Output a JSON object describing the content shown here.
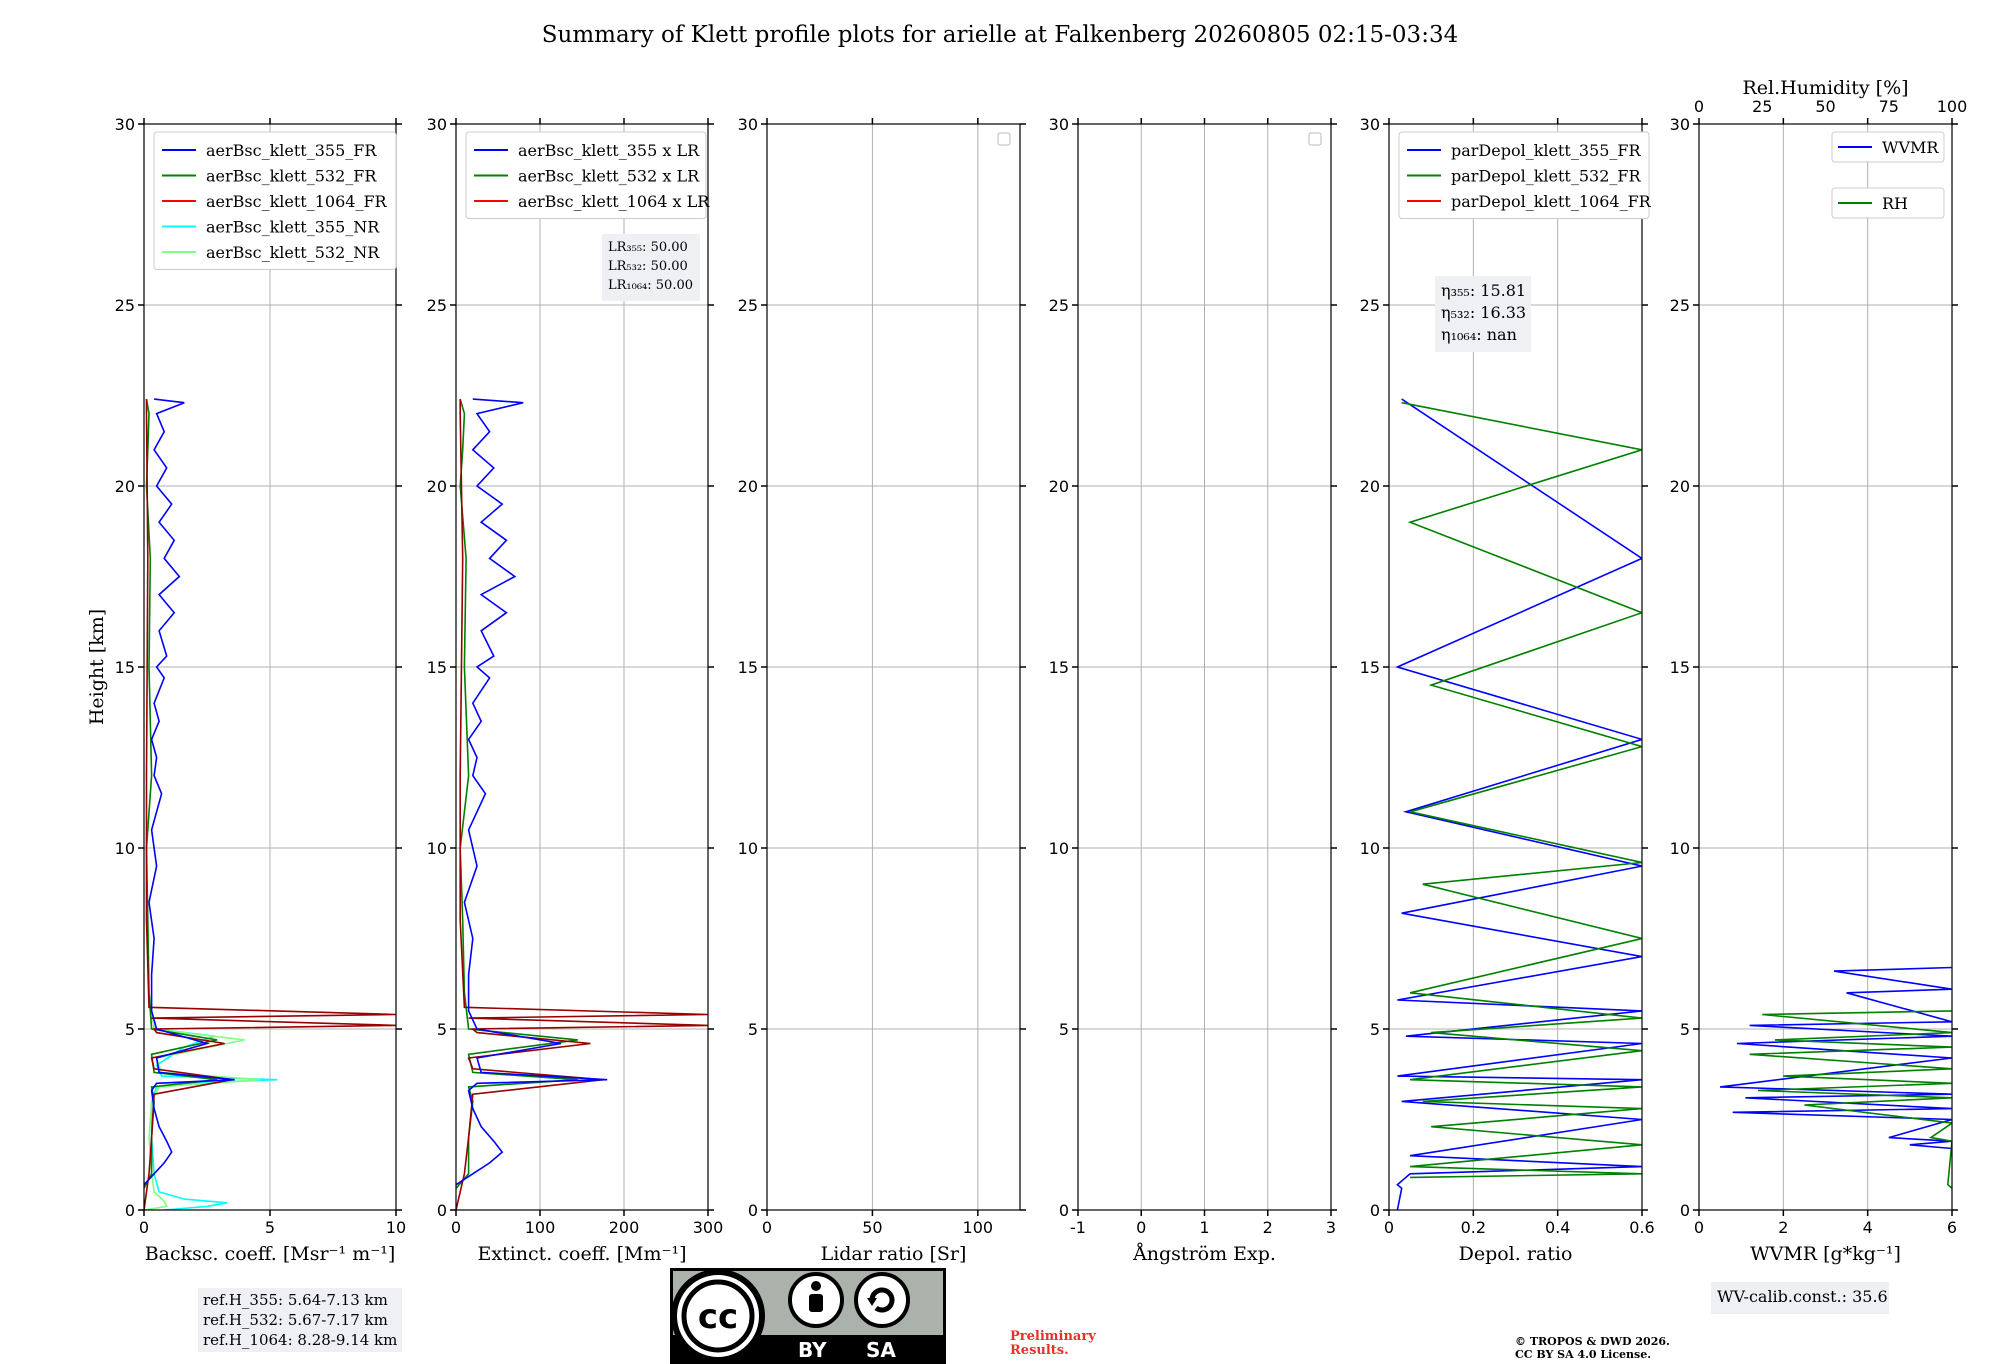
{
  "title": "Summary of Klett profile plots for arielle at Falkenberg 20260805 02:15-03:34",
  "colors": {
    "blue": "#0000ff",
    "green": "#008000",
    "red": "#ff0000",
    "cyan": "#00ffff",
    "lightgreen": "#80ff80",
    "darkred": "#990000"
  },
  "chart_data": [
    {
      "id": "backscatter",
      "type": "line",
      "xlabel": "Backsc. coeff. [Msr⁻¹ m⁻¹]",
      "ylabel": "Height [km]",
      "xlim": [
        0,
        10
      ],
      "ylim": [
        0,
        30
      ],
      "xticks": [
        0,
        5,
        10
      ],
      "yticks": [
        0,
        5,
        10,
        15,
        20,
        25,
        30
      ],
      "grid": true,
      "legend": {
        "position": "top-left",
        "entries": [
          {
            "label": "aerBsc_klett_355_FR",
            "color": "blue"
          },
          {
            "label": "aerBsc_klett_532_FR",
            "color": "green"
          },
          {
            "label": "aerBsc_klett_1064_FR",
            "color": "red"
          },
          {
            "label": "aerBsc_klett_355_NR",
            "color": "cyan"
          },
          {
            "label": "aerBsc_klett_532_NR",
            "color": "lightgreen"
          }
        ]
      },
      "series": [
        {
          "name": "aerBsc_klett_355_NR",
          "color": "cyan",
          "x": [
            0.8,
            2.5,
            3.3,
            1.6,
            0.6,
            0.4,
            0.3,
            0.3,
            0.5,
            1.6,
            5.3,
            0.7,
            0.5,
            1.6,
            2.8,
            0.5,
            0.3,
            0.2
          ],
          "y": [
            0.0,
            0.1,
            0.2,
            0.3,
            0.5,
            1.0,
            2.0,
            3.0,
            3.4,
            3.5,
            3.6,
            3.7,
            4.0,
            4.5,
            4.8,
            5.0,
            5.3,
            6.0
          ]
        },
        {
          "name": "aerBsc_klett_532_NR",
          "color": "lightgreen",
          "x": [
            0.0,
            0.9,
            0.8,
            0.4,
            0.3,
            0.2,
            0.3,
            0.6,
            4.6,
            0.7,
            0.5,
            4.0,
            0.4,
            0.2
          ],
          "y": [
            0.0,
            0.1,
            0.25,
            0.5,
            1.0,
            2.0,
            3.0,
            3.4,
            3.6,
            3.8,
            4.2,
            4.7,
            5.0,
            6.0
          ]
        },
        {
          "name": "aerBsc_klett_532_FR",
          "color": "green",
          "x": [
            0.0,
            0.3,
            0.3,
            0.4,
            0.3,
            2.9,
            0.4,
            0.3,
            2.9,
            0.3,
            0.2,
            0.15,
            0.1,
            0.3,
            0.2,
            0.25,
            0.1,
            0.15,
            0.2,
            0.1
          ],
          "y": [
            0.6,
            1.0,
            2.0,
            3.0,
            3.4,
            3.6,
            3.8,
            4.3,
            4.7,
            5.0,
            6.0,
            8.0,
            10.0,
            12.0,
            15.0,
            18.0,
            20.0,
            21.0,
            22.0,
            22.4
          ]
        },
        {
          "name": "aerBsc_klett_1064_FR",
          "color": "darkred",
          "x": [
            0.0,
            0.2,
            0.3,
            0.4,
            3.5,
            0.4,
            0.3,
            3.2,
            0.5,
            0.4,
            10.0,
            0.3,
            10.0,
            0.2,
            0.1,
            0.1,
            0.15,
            0.1,
            0.1
          ],
          "y": [
            0.0,
            1.0,
            2.0,
            3.2,
            3.6,
            3.9,
            4.2,
            4.6,
            4.9,
            5.0,
            5.1,
            5.3,
            5.4,
            5.6,
            8.0,
            12.0,
            18.0,
            22.0,
            22.4
          ]
        },
        {
          "name": "aerBsc_klett_355_FR",
          "color": "blue",
          "x": [
            0.0,
            0.4,
            0.8,
            1.1,
            0.9,
            0.6,
            0.4,
            0.3,
            0.5,
            3.6,
            0.6,
            0.5,
            2.5,
            0.5,
            0.3,
            0.3,
            0.4,
            0.2,
            0.5,
            0.3,
            0.7,
            0.4,
            0.5,
            0.3,
            0.6,
            0.4,
            0.8,
            0.5,
            0.9,
            0.6,
            1.2,
            0.6,
            1.4,
            0.8,
            1.2,
            0.6,
            1.1,
            0.5,
            0.9,
            0.4,
            0.8,
            0.5,
            1.6,
            0.4
          ],
          "y": [
            0.7,
            1.0,
            1.3,
            1.6,
            1.9,
            2.3,
            2.8,
            3.3,
            3.5,
            3.6,
            3.8,
            4.2,
            4.6,
            5.0,
            5.5,
            6.5,
            7.5,
            8.5,
            9.5,
            10.5,
            11.5,
            12.0,
            12.5,
            13.0,
            13.5,
            14.0,
            14.7,
            15.0,
            15.3,
            16.0,
            16.5,
            17.0,
            17.5,
            18.0,
            18.5,
            19.0,
            19.5,
            20.0,
            20.5,
            21.0,
            21.5,
            22.0,
            22.3,
            22.4
          ]
        }
      ]
    },
    {
      "id": "extinction",
      "type": "line",
      "xlabel": "Extinct. coeff. [Mm⁻¹]",
      "xlim": [
        0,
        300
      ],
      "ylim": [
        0,
        30
      ],
      "xticks": [
        0,
        100,
        200,
        300
      ],
      "yticks": [
        0,
        5,
        10,
        15,
        20,
        25,
        30
      ],
      "grid": true,
      "legend": {
        "position": "top-left",
        "entries": [
          {
            "label": "aerBsc_klett_355 x LR",
            "color": "blue"
          },
          {
            "label": "aerBsc_klett_532 x LR",
            "color": "green"
          },
          {
            "label": "aerBsc_klett_1064 x LR",
            "color": "red"
          }
        ]
      },
      "info": [
        "LR₃₅₅: 50.00",
        "LR₅₃₂: 50.00",
        "LR₁₀₆₄: 50.00"
      ],
      "series": [
        {
          "name": "aerBsc_klett_532 x LR",
          "color": "green",
          "x": [
            0,
            15,
            15,
            20,
            15,
            145,
            20,
            15,
            145,
            15,
            10,
            8,
            5,
            15,
            10,
            12,
            5,
            8,
            10,
            5
          ],
          "y": [
            0.6,
            1.0,
            2.0,
            3.0,
            3.4,
            3.6,
            3.8,
            4.3,
            4.7,
            5.0,
            6.0,
            8.0,
            10.0,
            12.0,
            15.0,
            18.0,
            20.0,
            21.0,
            22.0,
            22.4
          ]
        },
        {
          "name": "aerBsc_klett_1064 x LR",
          "color": "darkred",
          "x": [
            0,
            10,
            15,
            20,
            175,
            20,
            15,
            160,
            25,
            20,
            300,
            15,
            300,
            10,
            5,
            5,
            8,
            5,
            5
          ],
          "y": [
            0.0,
            1.0,
            2.0,
            3.2,
            3.6,
            3.9,
            4.2,
            4.6,
            4.9,
            5.0,
            5.1,
            5.3,
            5.4,
            5.6,
            8.0,
            12.0,
            18.0,
            22.0,
            22.4
          ]
        },
        {
          "name": "aerBsc_klett_355 x LR",
          "color": "blue",
          "x": [
            0,
            20,
            40,
            55,
            45,
            30,
            20,
            15,
            25,
            180,
            30,
            25,
            125,
            25,
            15,
            15,
            20,
            10,
            25,
            15,
            35,
            20,
            25,
            15,
            30,
            20,
            40,
            25,
            45,
            30,
            60,
            30,
            70,
            40,
            60,
            30,
            55,
            25,
            45,
            20,
            40,
            25,
            80,
            20
          ],
          "y": [
            0.7,
            1.0,
            1.3,
            1.6,
            1.9,
            2.3,
            2.8,
            3.3,
            3.5,
            3.6,
            3.8,
            4.2,
            4.6,
            5.0,
            5.5,
            6.5,
            7.5,
            8.5,
            9.5,
            10.5,
            11.5,
            12.0,
            12.5,
            13.0,
            13.5,
            14.0,
            14.7,
            15.0,
            15.3,
            16.0,
            16.5,
            17.0,
            17.5,
            18.0,
            18.5,
            19.0,
            19.5,
            20.0,
            20.5,
            21.0,
            21.5,
            22.0,
            22.3,
            22.4
          ]
        }
      ]
    },
    {
      "id": "lidar_ratio",
      "type": "line",
      "xlabel": "Lidar ratio [Sr]",
      "xlim": [
        0,
        120
      ],
      "ylim": [
        0,
        30
      ],
      "xticks": [
        0,
        50,
        100
      ],
      "yticks": [
        0,
        5,
        10,
        15,
        20,
        25,
        30
      ],
      "grid": true,
      "legend": {
        "position": "top-right",
        "entries": []
      },
      "series": []
    },
    {
      "id": "angstrom",
      "type": "line",
      "xlabel": "Ångström Exp.",
      "xlim": [
        -1,
        3
      ],
      "ylim": [
        0,
        30
      ],
      "xticks": [
        -1,
        0,
        1,
        2,
        3
      ],
      "yticks": [
        0,
        5,
        10,
        15,
        20,
        25,
        30
      ],
      "grid": true,
      "legend": {
        "position": "top-right",
        "entries": []
      },
      "series": []
    },
    {
      "id": "depol",
      "type": "line",
      "xlabel": "Depol. ratio",
      "xlim": [
        0,
        0.6
      ],
      "ylim": [
        0,
        30
      ],
      "xticks": [
        0.0,
        0.2,
        0.4,
        0.6
      ],
      "yticks": [
        0,
        5,
        10,
        15,
        20,
        25,
        30
      ],
      "grid": true,
      "legend": {
        "position": "top-left",
        "entries": [
          {
            "label": "parDepol_klett_355_FR",
            "color": "blue"
          },
          {
            "label": "parDepol_klett_532_FR",
            "color": "green"
          },
          {
            "label": "parDepol_klett_1064_FR",
            "color": "red"
          }
        ]
      },
      "info": [
        "η₃₅₅: 15.81",
        "η₅₃₂: 16.33",
        "η₁₀₆₄: nan"
      ],
      "series": [
        {
          "name": "parDepol_klett_355_FR",
          "color": "blue",
          "x": [
            0.02,
            0.03,
            0.02,
            0.05,
            0.6,
            0.05,
            0.6,
            0.03,
            0.6,
            0.02,
            0.6,
            0.04,
            0.6,
            0.02,
            0.6,
            0.03,
            0.6,
            0.04,
            0.6,
            0.02,
            0.6,
            0.03
          ],
          "y": [
            0.0,
            0.6,
            0.7,
            1.0,
            1.2,
            1.5,
            2.5,
            3.0,
            3.6,
            3.7,
            4.6,
            4.8,
            5.5,
            5.8,
            7.0,
            8.2,
            9.5,
            11.0,
            13.0,
            15.0,
            18.0,
            22.4
          ]
        },
        {
          "name": "parDepol_klett_532_FR",
          "color": "green",
          "x": [
            0.05,
            0.6,
            0.05,
            0.6,
            0.1,
            0.6,
            0.08,
            0.6,
            0.05,
            0.6,
            0.1,
            0.6,
            0.05,
            0.6,
            0.08,
            0.6,
            0.05,
            0.6,
            0.1,
            0.6,
            0.05,
            0.6,
            0.03
          ],
          "y": [
            0.9,
            1.0,
            1.2,
            1.8,
            2.3,
            2.8,
            3.0,
            3.4,
            3.6,
            4.4,
            4.9,
            5.3,
            6.0,
            7.5,
            9.0,
            9.6,
            11.0,
            12.8,
            14.5,
            16.5,
            19.0,
            21.0,
            22.3
          ]
        }
      ]
    },
    {
      "id": "wvmr",
      "type": "line",
      "xlabel": "WVMR [g*kg⁻¹]",
      "x2label": "Rel.Humidity [%]",
      "xlim": [
        0,
        6
      ],
      "x2lim": [
        0,
        100
      ],
      "ylim": [
        0,
        30
      ],
      "xticks": [
        0,
        2,
        4,
        6
      ],
      "x2ticks": [
        0,
        25,
        50,
        75,
        100
      ],
      "yticks": [
        0,
        5,
        10,
        15,
        20,
        25,
        30
      ],
      "grid": true,
      "legend": {
        "position": "top-right",
        "entries": [
          {
            "label": "WVMR",
            "color": "blue"
          },
          {
            "label": "RH",
            "color": "green"
          }
        ]
      },
      "info": [
        "WV-calib.const.: 35.6"
      ],
      "series": [
        {
          "name": "WVMR",
          "color": "blue",
          "x": [
            6.0,
            3.2,
            6.0,
            3.5,
            6.0,
            1.2,
            6.0,
            0.9,
            6.0,
            0.5,
            6.0,
            1.1,
            6.0,
            0.8,
            6.0,
            4.5,
            6.0,
            5.0,
            6.0
          ],
          "y": [
            6.7,
            6.6,
            6.1,
            6.0,
            5.2,
            5.1,
            4.8,
            4.6,
            4.2,
            3.4,
            3.2,
            3.1,
            2.8,
            2.7,
            2.5,
            2.0,
            1.9,
            1.8,
            1.7
          ]
        },
        {
          "name": "RH",
          "color": "green",
          "x": [
            6.0,
            1.5,
            6.0,
            1.8,
            6.0,
            1.2,
            6.0,
            2.0,
            6.0,
            1.4,
            6.0,
            2.5,
            6.0,
            5.5,
            6.0,
            5.9,
            6.0
          ],
          "y": [
            5.5,
            5.4,
            4.9,
            4.7,
            4.5,
            4.3,
            3.9,
            3.7,
            3.5,
            3.3,
            3.1,
            2.9,
            2.4,
            2.0,
            1.9,
            0.7,
            0.6
          ]
        }
      ]
    }
  ],
  "ref_heights": [
    "ref.H_355: 5.64-7.13 km",
    "ref.H_532: 5.67-7.17 km",
    "ref.H_1064: 8.28-9.14 km"
  ],
  "license": {
    "bottom_labels": [
      "BY",
      "SA"
    ],
    "cc_text": "cc"
  },
  "preliminary": [
    "Preliminary",
    "Results."
  ],
  "copyright": [
    "© TROPOS & DWD 2026.",
    "CC BY SA 4.0 License."
  ]
}
